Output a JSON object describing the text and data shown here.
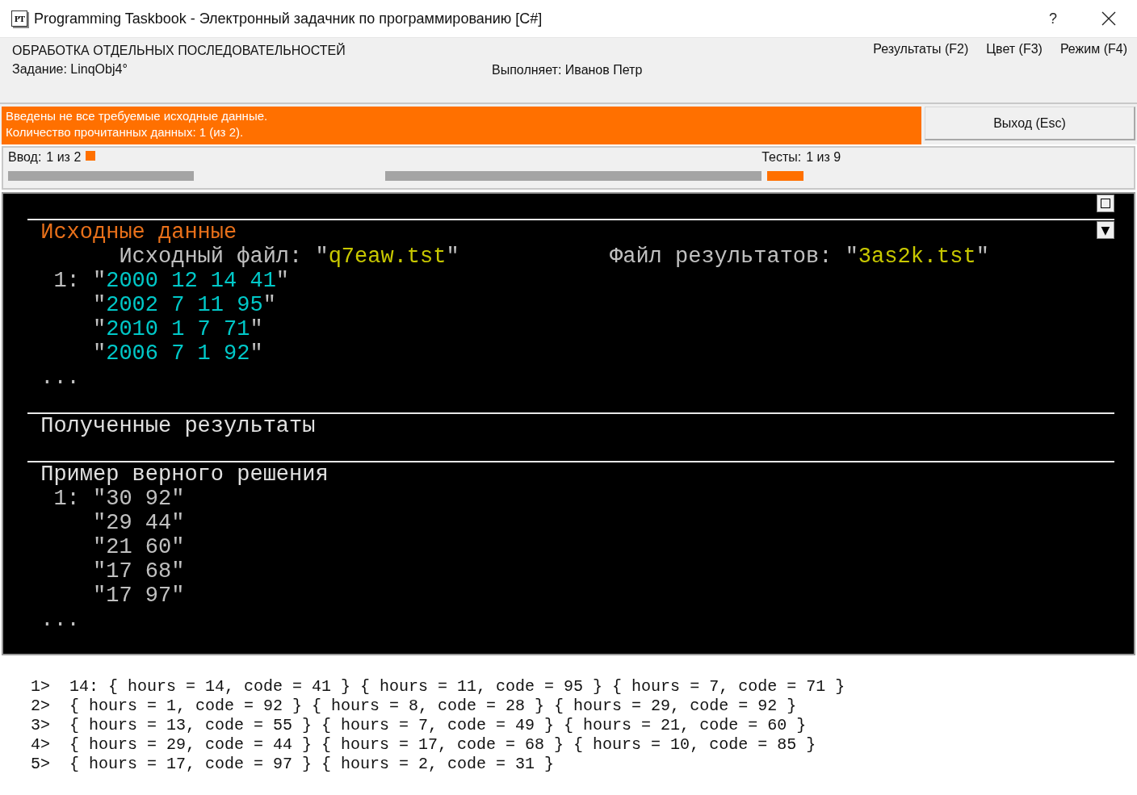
{
  "window": {
    "title": "Programming Taskbook - Электронный задачник по программированию [C#]",
    "icon_text": "PT",
    "help": "?"
  },
  "header": {
    "section": "ОБРАБОТКА ОТДЕЛЬНЫХ ПОСЛЕДОВАТЕЛЬНОСТЕЙ",
    "task": "Задание: LinqObj4°",
    "performer": "Выполняет: Иванов Петр",
    "menu": [
      "Результаты (F2)",
      "Цвет (F3)",
      "Режим (F4)"
    ]
  },
  "message": {
    "lines": [
      "Введены не все требуемые исходные данные.",
      "Количество прочитанных данных: 1 (из 2)."
    ]
  },
  "exit_button": "Выход (Esc)",
  "progress": {
    "input": {
      "label": "Ввод:",
      "count": "1 из 2",
      "level": 1
    },
    "tests": {
      "label": "Тесты:",
      "count": "1 из 9",
      "level": 0.1
    }
  },
  "console": {
    "scroll_button": "▼",
    "sections": [
      {
        "title": "Исходные данные",
        "kind": "source",
        "files": [
          [
            {
              "text": "Исходный файл: ",
              "kind": "label"
            },
            {
              "text": "\"",
              "kind": "label"
            },
            {
              "text": "q7eaw.tst",
              "kind": "file"
            },
            {
              "text": "\"",
              "kind": "label"
            }
          ],
          [
            {
              "text": "Файл результатов: ",
              "kind": "label"
            },
            {
              "text": "\"",
              "kind": "label"
            },
            {
              "text": "3as2k.tst",
              "kind": "file"
            },
            {
              "text": "\"",
              "kind": "label"
            }
          ]
        ],
        "rows": [
          {
            "index": "1:",
            "segments": [
              {
                "text": "\"",
                "kind": "label"
              },
              {
                "text": "2000 12 14 41",
                "kind": "data"
              },
              {
                "text": "\"",
                "kind": "label"
              }
            ]
          },
          {
            "segments": [
              {
                "text": "\"",
                "kind": "label"
              },
              {
                "text": "2002 7 11 95",
                "kind": "data"
              },
              {
                "text": "\"",
                "kind": "label"
              }
            ]
          },
          {
            "segments": [
              {
                "text": "\"",
                "kind": "label"
              },
              {
                "text": "2010 1 7 71",
                "kind": "data"
              },
              {
                "text": "\"",
                "kind": "label"
              }
            ]
          },
          {
            "segments": [
              {
                "text": "\"",
                "kind": "label"
              },
              {
                "text": "2006 7 1 92",
                "kind": "data"
              },
              {
                "text": "\"",
                "kind": "label"
              }
            ]
          }
        ],
        "ellipsis": "..."
      },
      {
        "title": "Полученные результаты",
        "kind": "results"
      },
      {
        "title": "Пример верного решения",
        "kind": "example",
        "rows": [
          {
            "index": "1:",
            "segments": [
              {
                "text": "\"30 92\"",
                "kind": "label"
              }
            ]
          },
          {
            "segments": [
              {
                "text": "\"29 44\"",
                "kind": "label"
              }
            ]
          },
          {
            "segments": [
              {
                "text": "\"21 60\"",
                "kind": "label"
              }
            ]
          },
          {
            "segments": [
              {
                "text": "\"17 68\"",
                "kind": "label"
              }
            ]
          },
          {
            "segments": [
              {
                "text": "\"17 97\"",
                "kind": "label"
              }
            ]
          }
        ],
        "ellipsis": "..."
      }
    ]
  },
  "log": [
    {
      "prompt": "1>",
      "text": "14: { hours = 14, code = 41 } { hours = 11, code = 95 } { hours = 7, code = 71 }"
    },
    {
      "prompt": "2>",
      "text": "{ hours = 1, code = 92 } { hours = 8, code = 28 } { hours = 29, code = 92 }"
    },
    {
      "prompt": "3>",
      "text": "{ hours = 13, code = 55 } { hours = 7, code = 49 } { hours = 21, code = 60 }"
    },
    {
      "prompt": "4>",
      "text": "{ hours = 29, code = 44 } { hours = 17, code = 68 } { hours = 10, code = 85 }"
    },
    {
      "prompt": "5>",
      "text": "{ hours = 17, code = 97 } { hours = 2, code = 31 }"
    }
  ]
}
